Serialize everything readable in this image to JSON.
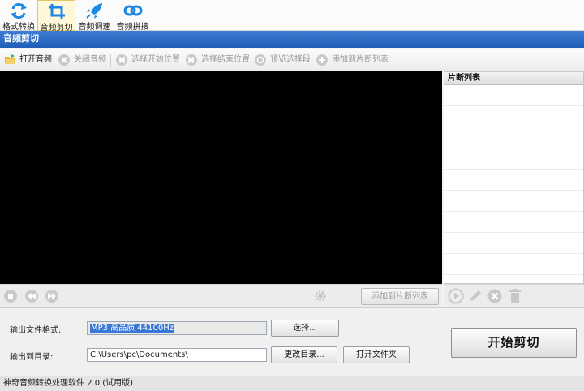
{
  "modes": [
    {
      "label": "格式转换",
      "icon": "convert-icon"
    },
    {
      "label": "音频剪切",
      "icon": "crop-icon",
      "active": true
    },
    {
      "label": "音频调速",
      "icon": "speed-rocket-icon"
    },
    {
      "label": "音频拼接",
      "icon": "join-icon"
    }
  ],
  "title": "音频剪切",
  "toolbar": {
    "open": "打开音频",
    "close": "关闭音频",
    "select_start": "选择开始位置",
    "select_end": "选择结束位置",
    "preview": "预览选择段",
    "add_to_list": "添加到片断列表"
  },
  "segment_list": {
    "header": "片断列表"
  },
  "transport": {
    "add_to_list_button": "添加到片断列表"
  },
  "output": {
    "format_label": "输出文件格式:",
    "format_value": "MP3 高品质 44100Hz",
    "choose_button": "选择...",
    "dir_label": "输出到目录:",
    "dir_value": "C:\\Users\\pc\\Documents\\",
    "change_dir_button": "更改目录...",
    "open_folder_button": "打开文件夹",
    "start_button": "开始剪切"
  },
  "status": "神奇音频转换处理软件 2.0 (试用版)",
  "colors": {
    "title_bar": "#2a66c0",
    "accent_blue": "#1e88e5",
    "video_bg": "#000000"
  }
}
